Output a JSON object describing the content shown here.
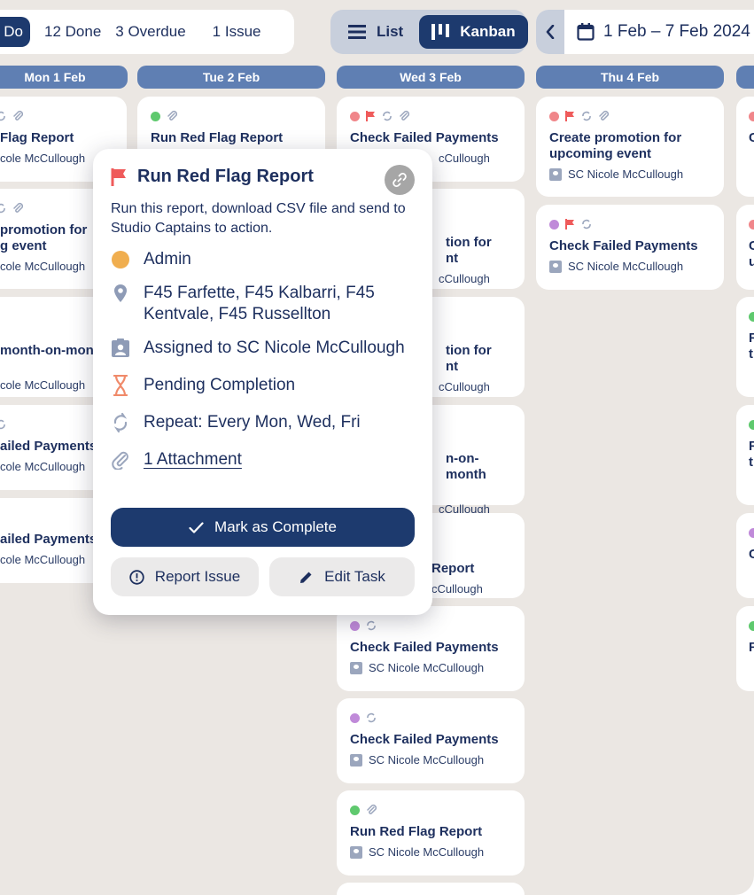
{
  "toolbar": {
    "status_filters": {
      "active": "Do",
      "done": "12 Done",
      "overdue": "3 Overdue",
      "issue": "1 Issue"
    },
    "views": {
      "list": "List",
      "kanban": "Kanban",
      "selected": "Kanban"
    },
    "date_range": "1 Feb – 7 Feb 2024"
  },
  "days": [
    {
      "label": "Mon 1 Feb"
    },
    {
      "label": "Tue 2 Feb"
    },
    {
      "label": "Wed 3 Feb"
    },
    {
      "label": "Thu 4 Feb"
    },
    {
      "label": ""
    }
  ],
  "tasks": {
    "mon": [
      {
        "title": "Flag Report",
        "assignee": "cole McCullough"
      },
      {
        "title": "promotion for\ng event",
        "assignee": "cole McCullough"
      },
      {
        "title": "month-on-mont",
        "assignee": "cole McCullough"
      },
      {
        "title": "ailed Payments",
        "assignee": "cole McCullough"
      },
      {
        "title": "ailed Payments",
        "assignee": "cole McCullough"
      }
    ],
    "tue": [
      {
        "title": "Run Red Flag Report",
        "assignee": ""
      }
    ],
    "wed": [
      {
        "title": "Check Failed Payments",
        "assignee": "cCullough"
      },
      {
        "title": "tion for\nnt",
        "assignee": "cCullough"
      },
      {
        "title": "tion for\nnt",
        "assignee": "cCullough"
      },
      {
        "title": "n-on-month",
        "assignee": "cCullough"
      },
      {
        "title": "Report",
        "assignee": "cCullough"
      },
      {
        "title": "Check Failed Payments",
        "assignee": "SC Nicole McCullough"
      },
      {
        "title": "Check Failed Payments",
        "assignee": "SC Nicole McCullough"
      },
      {
        "title": "Run Red Flag Report",
        "assignee": "SC Nicole McCullough"
      }
    ],
    "thu": [
      {
        "title": "Create promotion for upcoming event",
        "assignee": "SC Nicole McCullough"
      },
      {
        "title": "Check Failed Payments",
        "assignee": "SC Nicole McCullough"
      }
    ],
    "fri": [
      {
        "title": "C"
      },
      {
        "title": "C\nu"
      },
      {
        "title": "R\nt"
      },
      {
        "title": "R\nt"
      },
      {
        "title": "C"
      },
      {
        "title": "F"
      }
    ]
  },
  "popover": {
    "title": "Run Red Flag Report",
    "description": "Run this report, download CSV file and send to Studio Captains to action.",
    "category": "Admin",
    "locations": "F45 Farfette, F45 Kalbarri, F45 Kentvale, F45 Russellton",
    "assigned": "Assigned to SC Nicole McCullough",
    "status": "Pending Completion",
    "repeat": "Repeat: Every Mon, Wed, Fri",
    "attachments": "1 Attachment",
    "complete_label": "Mark as Complete",
    "report_label": "Report Issue",
    "edit_label": "Edit Task"
  },
  "colors": {
    "navy": "#1d3a6e",
    "header_blue": "#5f7fb3",
    "background": "#ebe7e3",
    "dot_red": "#f0868a",
    "dot_purple": "#c08ad9",
    "dot_green": "#5fc96e",
    "dot_orange": "#f0ae4f",
    "flag_red": "#ef5b5b"
  }
}
